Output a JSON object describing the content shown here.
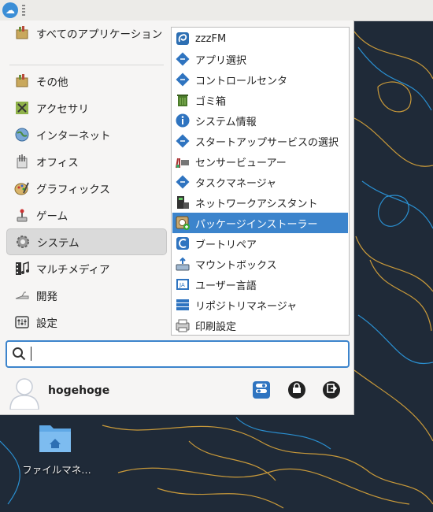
{
  "colors": {
    "accent": "#3c84cc",
    "desktop": "#1f2a38",
    "contour_a": "#2a8fd0",
    "contour_b": "#c99a3a"
  },
  "categories": [
    {
      "label": "すべてのアプリケーション",
      "icon": "all-apps-icon"
    },
    {
      "label": "その他",
      "icon": "other-icon"
    },
    {
      "label": "アクセサリ",
      "icon": "accessories-icon"
    },
    {
      "label": "インターネット",
      "icon": "internet-globe-icon"
    },
    {
      "label": "オフィス",
      "icon": "office-icon"
    },
    {
      "label": "グラフィックス",
      "icon": "graphics-icon"
    },
    {
      "label": "ゲーム",
      "icon": "game-joystick-icon"
    },
    {
      "label": "システム",
      "icon": "system-gear-icon",
      "selected": true
    },
    {
      "label": "マルチメディア",
      "icon": "multimedia-icon"
    },
    {
      "label": "開発",
      "icon": "development-icon"
    },
    {
      "label": "設定",
      "icon": "settings-icon"
    }
  ],
  "apps": [
    {
      "label": "zzzFM",
      "icon": "zzzfm-icon"
    },
    {
      "label": "アプリ選択",
      "icon": "app-select-icon"
    },
    {
      "label": "コントロールセンタ",
      "icon": "control-center-icon"
    },
    {
      "label": "ゴミ箱",
      "icon": "trash-icon"
    },
    {
      "label": "システム情報",
      "icon": "info-icon"
    },
    {
      "label": "スタートアップサービスの選択",
      "icon": "startup-services-icon"
    },
    {
      "label": "センサービューアー",
      "icon": "sensor-viewer-icon"
    },
    {
      "label": "タスクマネージャ",
      "icon": "task-manager-icon"
    },
    {
      "label": "ネットワークアシスタント",
      "icon": "network-assistant-icon"
    },
    {
      "label": "パッケージインストーラー",
      "icon": "package-installer-icon",
      "selected": true
    },
    {
      "label": "ブートリペア",
      "icon": "boot-repair-icon"
    },
    {
      "label": "マウントボックス",
      "icon": "mountbox-icon"
    },
    {
      "label": "ユーザー言語",
      "icon": "user-language-icon"
    },
    {
      "label": "リポジトリマネージャ",
      "icon": "repository-manager-icon"
    },
    {
      "label": "印刷設定",
      "icon": "print-settings-icon"
    }
  ],
  "search": {
    "value": "",
    "placeholder": ""
  },
  "user": {
    "name": "hogehoge"
  },
  "desktop_icon": {
    "label": "ファイルマネ…"
  }
}
